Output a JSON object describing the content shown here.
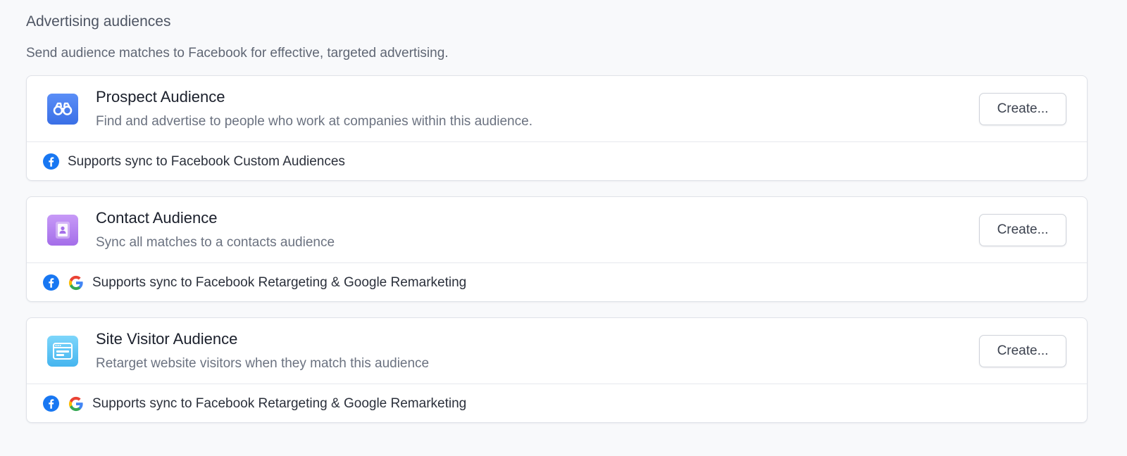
{
  "section": {
    "title": "Advertising audiences",
    "description": "Send audience matches to Facebook for effective, targeted advertising."
  },
  "cards": [
    {
      "name": "Prospect Audience",
      "description": "Find and advertise to people who work at companies within this audience.",
      "icon": "binoculars-icon",
      "button_label": "Create...",
      "sync_text": "Supports sync to Facebook Custom Audiences",
      "sync_icons": [
        "facebook-icon"
      ]
    },
    {
      "name": "Contact Audience",
      "description": "Sync all matches to a contacts audience",
      "icon": "contact-book-icon",
      "button_label": "Create...",
      "sync_text": "Supports sync to Facebook Retargeting & Google Remarketing",
      "sync_icons": [
        "facebook-icon",
        "google-icon"
      ]
    },
    {
      "name": "Site Visitor Audience",
      "description": "Retarget website visitors when they match this audience",
      "icon": "browser-window-icon",
      "button_label": "Create...",
      "sync_text": "Supports sync to Facebook Retargeting & Google Remarketing",
      "sync_icons": [
        "facebook-icon",
        "google-icon"
      ]
    }
  ],
  "colors": {
    "prospect_icon_bg": "#3a6fe6",
    "contact_icon_bg": "#a46ee9",
    "visitor_icon_bg": "#45b5ef",
    "facebook": "#1877f2"
  }
}
